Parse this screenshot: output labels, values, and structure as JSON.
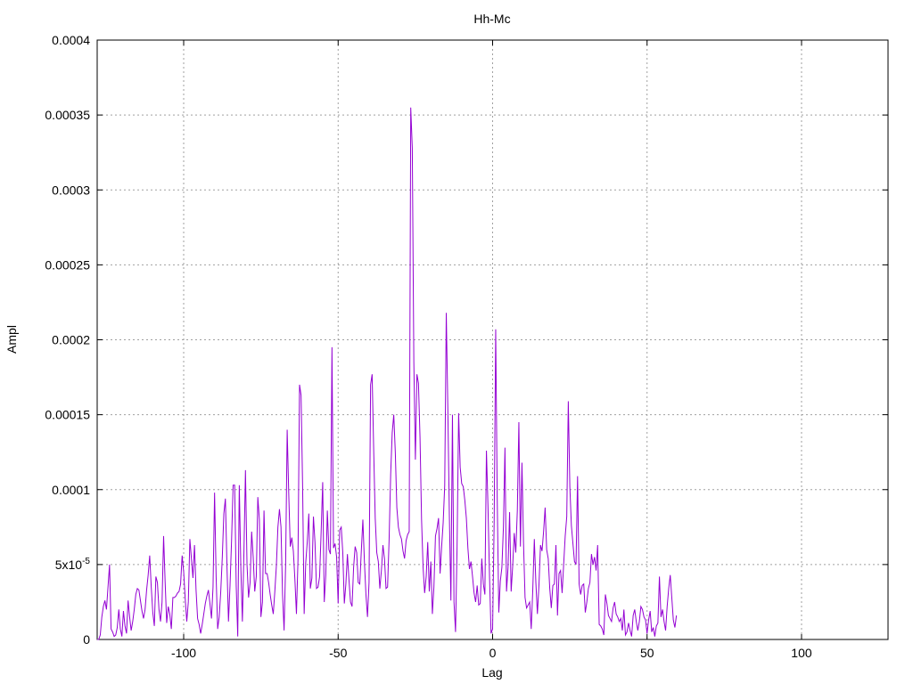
{
  "chart_data": {
    "type": "line",
    "title": "Hh-Mc",
    "xlabel": "Lag",
    "ylabel": "Ampl",
    "xlim": [
      -128,
      128
    ],
    "ylim": [
      0,
      0.0004
    ],
    "grid": true,
    "x_ticks": [
      -100,
      -50,
      0,
      50,
      100
    ],
    "x_tick_labels": [
      "-100",
      "-50",
      "0",
      "50",
      "100"
    ],
    "y_ticks": [
      0,
      5e-05,
      0.0001,
      0.00015,
      0.0002,
      0.00025,
      0.0003,
      0.00035,
      0.0004
    ],
    "y_tick_labels": [
      "0",
      "5x10-5",
      "0.0001",
      "0.00015",
      "0.0002",
      "0.00025",
      "0.0003",
      "0.00035",
      "0.0004"
    ],
    "colors": {
      "series": "#9400d3",
      "grid": "#a0a0a0",
      "axis": "#000000"
    },
    "series": [
      {
        "x_start": -128,
        "x_step": 0.5,
        "values": [
          0,
          0,
          3e-06,
          1.5e-05,
          2.2e-05,
          2.6e-05,
          2e-05,
          3.5e-05,
          5e-05,
          7e-06,
          5e-06,
          2e-06,
          3e-06,
          8e-06,
          2e-05,
          7e-06,
          2e-06,
          1.9e-05,
          9e-06,
          4e-06,
          2.6e-05,
          1.5e-05,
          6e-06,
          1.2e-05,
          2e-05,
          3e-05,
          3.4e-05,
          3.3e-05,
          2.6e-05,
          1.9e-05,
          1.4e-05,
          2e-05,
          3.3e-05,
          4.3e-05,
          5.6e-05,
          3.5e-05,
          1.8e-05,
          9e-06,
          4.2e-05,
          3.8e-05,
          2e-05,
          1.2e-05,
          2.5e-05,
          6.9e-05,
          3.8e-05,
          1.1e-05,
          2.2e-05,
          1.7e-05,
          7e-06,
          2.8e-05,
          2.8e-05,
          2.9e-05,
          3.1e-05,
          3.2e-05,
          3.7e-05,
          5.6e-05,
          4.5e-05,
          2.7e-05,
          1.2e-05,
          2.5e-05,
          6.7e-05,
          5.4e-05,
          4.1e-05,
          6.3e-05,
          3.3e-05,
          1.4e-05,
          1e-05,
          4e-06,
          1e-05,
          1.7e-05,
          2.4e-05,
          2.9e-05,
          3.3e-05,
          2.4e-05,
          1.4e-05,
          3.5e-05,
          9.8e-05,
          4.2e-05,
          7e-06,
          1.5e-05,
          3.2e-05,
          5.5e-05,
          8.4e-05,
          9.4e-05,
          5e-05,
          1.2e-05,
          3.6e-05,
          6.6e-05,
          0.000103,
          0.000103,
          3.6e-05,
          2e-06,
          0.000103,
          4.8e-05,
          1.2e-05,
          5.8e-05,
          0.000113,
          5e-05,
          2.8e-05,
          3.8e-05,
          7.2e-05,
          5.5e-05,
          3.2e-05,
          4.2e-05,
          9.5e-05,
          8e-05,
          1.5e-05,
          2.5e-05,
          8.6e-05,
          4.4e-05,
          4.4e-05,
          3.8e-05,
          3e-05,
          2.3e-05,
          1.7e-05,
          3.2e-05,
          4.9e-05,
          7.5e-05,
          8.7e-05,
          7.5e-05,
          3e-05,
          6e-06,
          5e-05,
          0.00014,
          9.8e-05,
          6.2e-05,
          6.8e-05,
          5.9e-05,
          4e-05,
          1.7e-05,
          5.3e-05,
          0.00017,
          0.000163,
          0.000102,
          1.7e-05,
          5.1e-05,
          6.5e-05,
          8.4e-05,
          3.4e-05,
          4.1e-05,
          8.2e-05,
          6.5e-05,
          3.4e-05,
          3.5e-05,
          4.2e-05,
          7.2e-05,
          0.000105,
          2.5e-05,
          4.3e-05,
          8.6e-05,
          6e-05,
          5.7e-05,
          0.000195,
          6.1e-05,
          6.4e-05,
          5.5e-05,
          2.4e-05,
          7.3e-05,
          7.5e-05,
          5.8e-05,
          2.4e-05,
          3.7e-05,
          5.7e-05,
          4e-05,
          2.5e-05,
          2.2e-05,
          4.8e-05,
          6.2e-05,
          5.8e-05,
          3.8e-05,
          3.7e-05,
          5.9e-05,
          8e-05,
          5.2e-05,
          3e-05,
          1.5e-05,
          3.8e-05,
          0.00017,
          0.000177,
          0.000127,
          8.1e-05,
          5.8e-05,
          5.2e-05,
          3.4e-05,
          4.6e-05,
          6.3e-05,
          5.4e-05,
          3.4e-05,
          3.5e-05,
          6.7e-05,
          0.00011,
          0.000138,
          0.00015,
          0.000125,
          8.8e-05,
          7.5e-05,
          7e-05,
          6.7e-05,
          5.9e-05,
          5.4e-05,
          6.6e-05,
          7e-05,
          7.2e-05,
          0.000355,
          0.000328,
          0.000185,
          0.00012,
          0.000177,
          0.000171,
          0.000135,
          8e-05,
          4.8e-05,
          3.1e-05,
          4.2e-05,
          6.5e-05,
          3.2e-05,
          5.2e-05,
          1.7e-05,
          3.5e-05,
          6.9e-05,
          7.4e-05,
          8.1e-05,
          4.4e-05,
          6.2e-05,
          7.8e-05,
          0.000103,
          0.000218,
          0.000155,
          8.3e-05,
          2.6e-05,
          0.00015,
          2.5e-05,
          5e-06,
          6.2e-05,
          0.000151,
          0.000115,
          0.000104,
          0.000102,
          9.3e-05,
          8.1e-05,
          6.1e-05,
          4.7e-05,
          5.2e-05,
          4.2e-05,
          3.1e-05,
          2.5e-05,
          3.6e-05,
          2.3e-05,
          2.4e-05,
          5.4e-05,
          3.7e-05,
          3e-05,
          0.000126,
          8.9e-05,
          4.2e-05,
          4e-06,
          7e-06,
          7.8e-05,
          0.000207,
          9.3e-05,
          1.8e-05,
          3.9e-05,
          4.8e-05,
          7.5e-05,
          0.000128,
          3.2e-05,
          4.8e-05,
          8.5e-05,
          3.2e-05,
          4.9e-05,
          7.1e-05,
          5.8e-05,
          8.6e-05,
          0.000145,
          6.2e-05,
          0.000118,
          6.5e-05,
          2.8e-05,
          2.1e-05,
          2.3e-05,
          2.5e-05,
          7e-06,
          3.3e-05,
          6.7e-05,
          3.8e-05,
          1.7e-05,
          3.6e-05,
          6.3e-05,
          5.9e-05,
          7.2e-05,
          8.8e-05,
          6e-05,
          5.4e-05,
          3.4e-05,
          2.1e-05,
          3.6e-05,
          3.7e-05,
          6.3e-05,
          1.6e-05,
          4.4e-05,
          4.6e-05,
          3.1e-05,
          5e-05,
          6.9e-05,
          8.2e-05,
          0.000159,
          0.000102,
          7.6e-05,
          6.4e-05,
          5.2e-05,
          5e-05,
          0.000109,
          3.7e-05,
          3e-05,
          3.6e-05,
          3.7e-05,
          1.8e-05,
          2.5e-05,
          3.4e-05,
          3.8e-05,
          5.7e-05,
          5e-05,
          5.5e-05,
          4.6e-05,
          6.3e-05,
          1e-05,
          9e-06,
          7e-06,
          3e-06,
          3e-05,
          2.4e-05,
          1.6e-05,
          1.4e-05,
          1.2e-05,
          2.1e-05,
          2.5e-05,
          1.7e-05,
          1.5e-05,
          1.2e-05,
          1.4e-05,
          6e-06,
          2e-05,
          3e-06,
          5e-06,
          1.1e-05,
          6e-06,
          2e-06,
          1.6e-05,
          2e-05,
          1.2e-05,
          6e-06,
          1.2e-05,
          2.2e-05,
          2e-05,
          1.5e-05,
          1.3e-05,
          4e-06,
          1.3e-05,
          1.9e-05,
          5e-06,
          8e-06,
          2e-06,
          9e-06,
          1.1e-05,
          4.2e-05,
          1.5e-05,
          2e-05,
          1.2e-05,
          6e-06,
          2.2e-05,
          3.4e-05,
          4.3e-05,
          2.8e-05,
          1.3e-05,
          8e-06,
          1.6e-05
        ]
      }
    ]
  }
}
